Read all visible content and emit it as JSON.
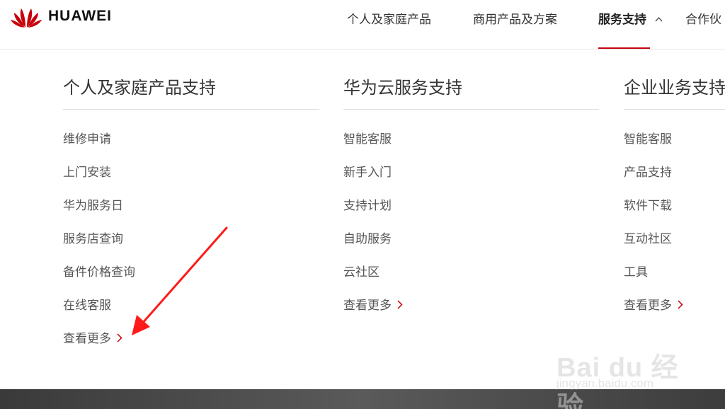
{
  "brand": {
    "name": "HUAWEI",
    "logo_icon": "huawei-petal-logo",
    "color": "#c7000b"
  },
  "nav": {
    "items": [
      {
        "label": "个人及家庭产品"
      },
      {
        "label": "商用产品及方案"
      },
      {
        "label": "服务支持",
        "active": true,
        "icon": "chevron-up-icon"
      },
      {
        "label": "合作伙"
      }
    ]
  },
  "columns": [
    {
      "title": "个人及家庭产品支持",
      "links": [
        "维修申请",
        "上门安装",
        "华为服务日",
        "服务店查询",
        "备件价格查询",
        "在线客服"
      ],
      "more": "查看更多"
    },
    {
      "title": "华为云服务支持",
      "links": [
        "智能客服",
        "新手入门",
        "支持计划",
        "自助服务",
        "云社区"
      ],
      "more": "查看更多"
    },
    {
      "title": "企业业务支持",
      "links": [
        "智能客服",
        "产品支持",
        "软件下载",
        "互动社区",
        "工具"
      ],
      "more": "查看更多"
    }
  ],
  "watermark": {
    "main": "Bai du 经验",
    "sub": "jingyan.baidu.com"
  },
  "colors": {
    "accent": "#c7000b",
    "annotation_arrow": "#ff1a1a"
  }
}
